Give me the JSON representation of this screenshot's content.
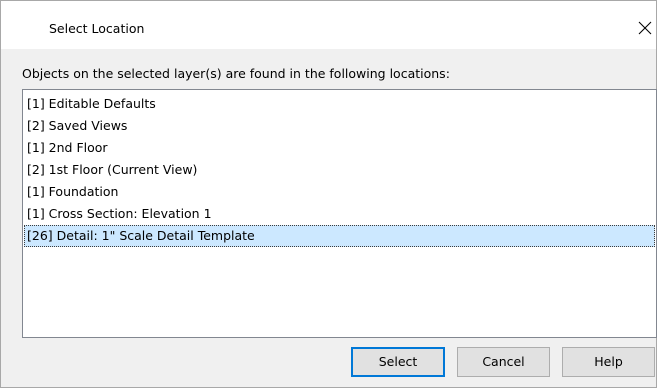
{
  "window": {
    "title": "Select Location",
    "close_label": "Close"
  },
  "instruction": "Objects on the selected layer(s) are found in the following locations:",
  "locations": {
    "items": [
      {
        "label": "[1] Editable Defaults",
        "selected": false
      },
      {
        "label": "[2] Saved Views",
        "selected": false
      },
      {
        "label": "[1] 2nd Floor",
        "selected": false
      },
      {
        "label": "[2] 1st Floor (Current View)",
        "selected": false
      },
      {
        "label": "[1] Foundation",
        "selected": false
      },
      {
        "label": "[1] Cross Section: Elevation 1",
        "selected": false
      },
      {
        "label": "[26] Detail: 1\" Scale Detail Template",
        "selected": true
      }
    ]
  },
  "buttons": {
    "select": "Select",
    "cancel": "Cancel",
    "help": "Help"
  },
  "colors": {
    "dialog_bg": "#f0f0f0",
    "list_bg": "#ffffff",
    "selection_bg": "#cce8ff",
    "default_button_border": "#0078d7",
    "button_bg": "#e1e1e1"
  },
  "icons": {
    "close": "close-icon"
  }
}
